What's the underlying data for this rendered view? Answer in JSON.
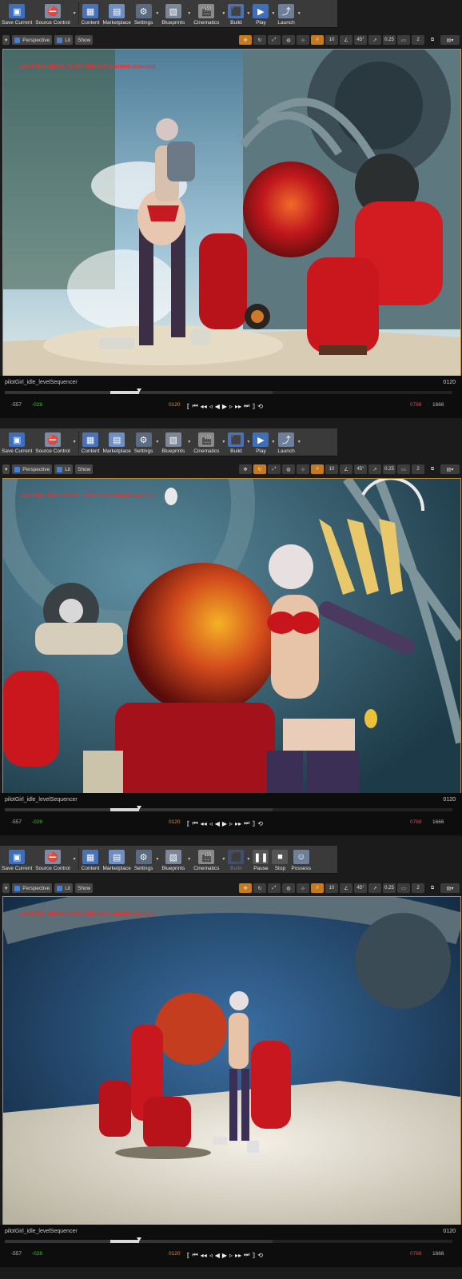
{
  "toolbar": {
    "buttons": [
      {
        "label": "Save Current",
        "icon": "save-icon"
      },
      {
        "label": "Source Control",
        "icon": "source-control-icon"
      },
      {
        "label": "Content",
        "icon": "content-icon"
      },
      {
        "label": "Marketplace",
        "icon": "marketplace-icon"
      },
      {
        "label": "Settings",
        "icon": "settings-icon"
      },
      {
        "label": "Blueprints",
        "icon": "blueprints-icon"
      },
      {
        "label": "Cinematics",
        "icon": "cinematics-icon"
      },
      {
        "label": "Build",
        "icon": "build-icon"
      },
      {
        "label": "Play",
        "icon": "play-icon"
      },
      {
        "label": "Launch",
        "icon": "launch-icon"
      }
    ],
    "playing_buttons": [
      {
        "label": "Save Current",
        "icon": "save-icon"
      },
      {
        "label": "Source Control",
        "icon": "source-control-icon"
      },
      {
        "label": "Content",
        "icon": "content-icon"
      },
      {
        "label": "Marketplace",
        "icon": "marketplace-icon"
      },
      {
        "label": "Settings",
        "icon": "settings-icon"
      },
      {
        "label": "Blueprints",
        "icon": "blueprints-icon"
      },
      {
        "label": "Cinematics",
        "icon": "cinematics-icon"
      },
      {
        "label": "Build",
        "icon": "build-icon"
      },
      {
        "label": "Pause",
        "icon": "pause-icon"
      },
      {
        "label": "Stop",
        "icon": "stop-icon"
      },
      {
        "label": "Possess",
        "icon": "possess-icon"
      }
    ]
  },
  "viewport_bar": {
    "perspective": "Perspective",
    "lit": "Lit",
    "show": "Show",
    "grid_size": "10",
    "angle": "45°",
    "scale": "0.25",
    "camera_speed": "2"
  },
  "viewport": {
    "warning": "LIGHTING NEEDS TO BE REBUILT (3 unbuilt object(s))"
  },
  "sequencer": {
    "name": "pilotGirl_idle_levelSequencer",
    "current_frame": "0120",
    "view_start": "-557",
    "play_start": "-028",
    "play_current": "0120",
    "play_end": "0788",
    "view_end": "1666",
    "playhead_fraction": 0.3
  },
  "colors": {
    "accent": "#c77a1c",
    "warning": "#e53333",
    "range_start": "#3ac23a",
    "range_end": "#d84a4a"
  }
}
